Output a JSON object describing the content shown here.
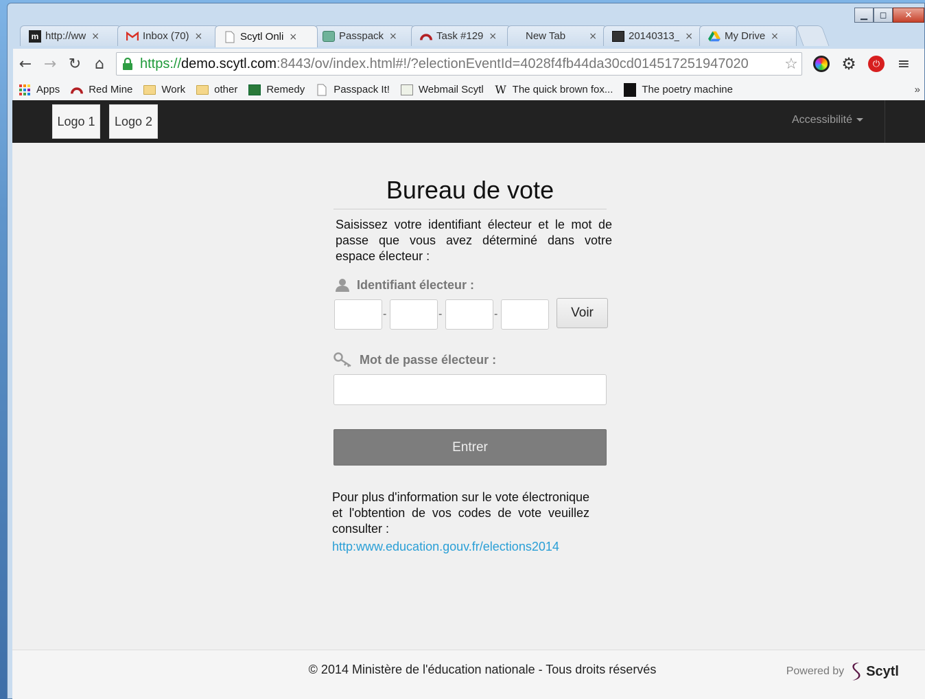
{
  "browser": {
    "tabs": [
      {
        "label": "http://ww",
        "icon": "tab-favicon-m-black"
      },
      {
        "label": "Inbox (70)",
        "icon": "gmail-icon"
      },
      {
        "label": "Scytl Onli",
        "icon": "page-icon",
        "active": true
      },
      {
        "label": "Passpack",
        "icon": "passpack-icon"
      },
      {
        "label": "Task #129",
        "icon": "redmine-icon"
      },
      {
        "label": "New Tab",
        "icon": ""
      },
      {
        "label": "20140313_",
        "icon": "image-icon"
      },
      {
        "label": "My Drive",
        "icon": "drive-icon"
      }
    ],
    "url": {
      "scheme": "https://",
      "host": "demo.scytl.com",
      "rest": ":8443/ov/index.html#!/?electionEventId=4028f4fb44da30cd014517251947020"
    },
    "bookmarks": [
      {
        "label": "Apps",
        "icon": "apps-grid-icon"
      },
      {
        "label": "Red Mine",
        "icon": "redmine-icon"
      },
      {
        "label": "Work",
        "icon": "folder-icon"
      },
      {
        "label": "other",
        "icon": "folder-icon"
      },
      {
        "label": "Remedy",
        "icon": "remedy-icon"
      },
      {
        "label": "Passpack It!",
        "icon": "page-icon"
      },
      {
        "label": "Webmail Scytl",
        "icon": "webmail-icon"
      },
      {
        "label": "The quick brown fox...",
        "icon": "wikipedia-icon"
      },
      {
        "label": "The poetry machine",
        "icon": "poetry-icon"
      }
    ],
    "bookmarks_more": "»"
  },
  "navbar": {
    "logo1": "Logo 1",
    "logo2": "Logo 2",
    "accessibility": "Accessibilité"
  },
  "main": {
    "title": "Bureau de vote",
    "intro": "Saisissez votre identifiant électeur et le mot de passe que vous avez déterminé dans votre espace électeur :",
    "id_label": "Identifiant électeur :",
    "id_separator": "-",
    "voir_label": "Voir",
    "password_label": "Mot de passe électeur :",
    "enter_label": "Entrer",
    "info": "Pour plus d'information sur le vote électronique et l'obtention de vos codes de vote veuillez consulter :",
    "link": "http:www.education.gouv.fr/elections2014"
  },
  "footer": {
    "copyright": "© 2014 Ministère de l'éducation nationale - Tous droits réservés",
    "powered_by": "Powered by",
    "brand": "Scytl"
  },
  "colors": {
    "navbar": "#222222",
    "link": "#2a9fd6",
    "enter_button": "#7d7d7d",
    "page_bg": "#f0f0f0"
  }
}
